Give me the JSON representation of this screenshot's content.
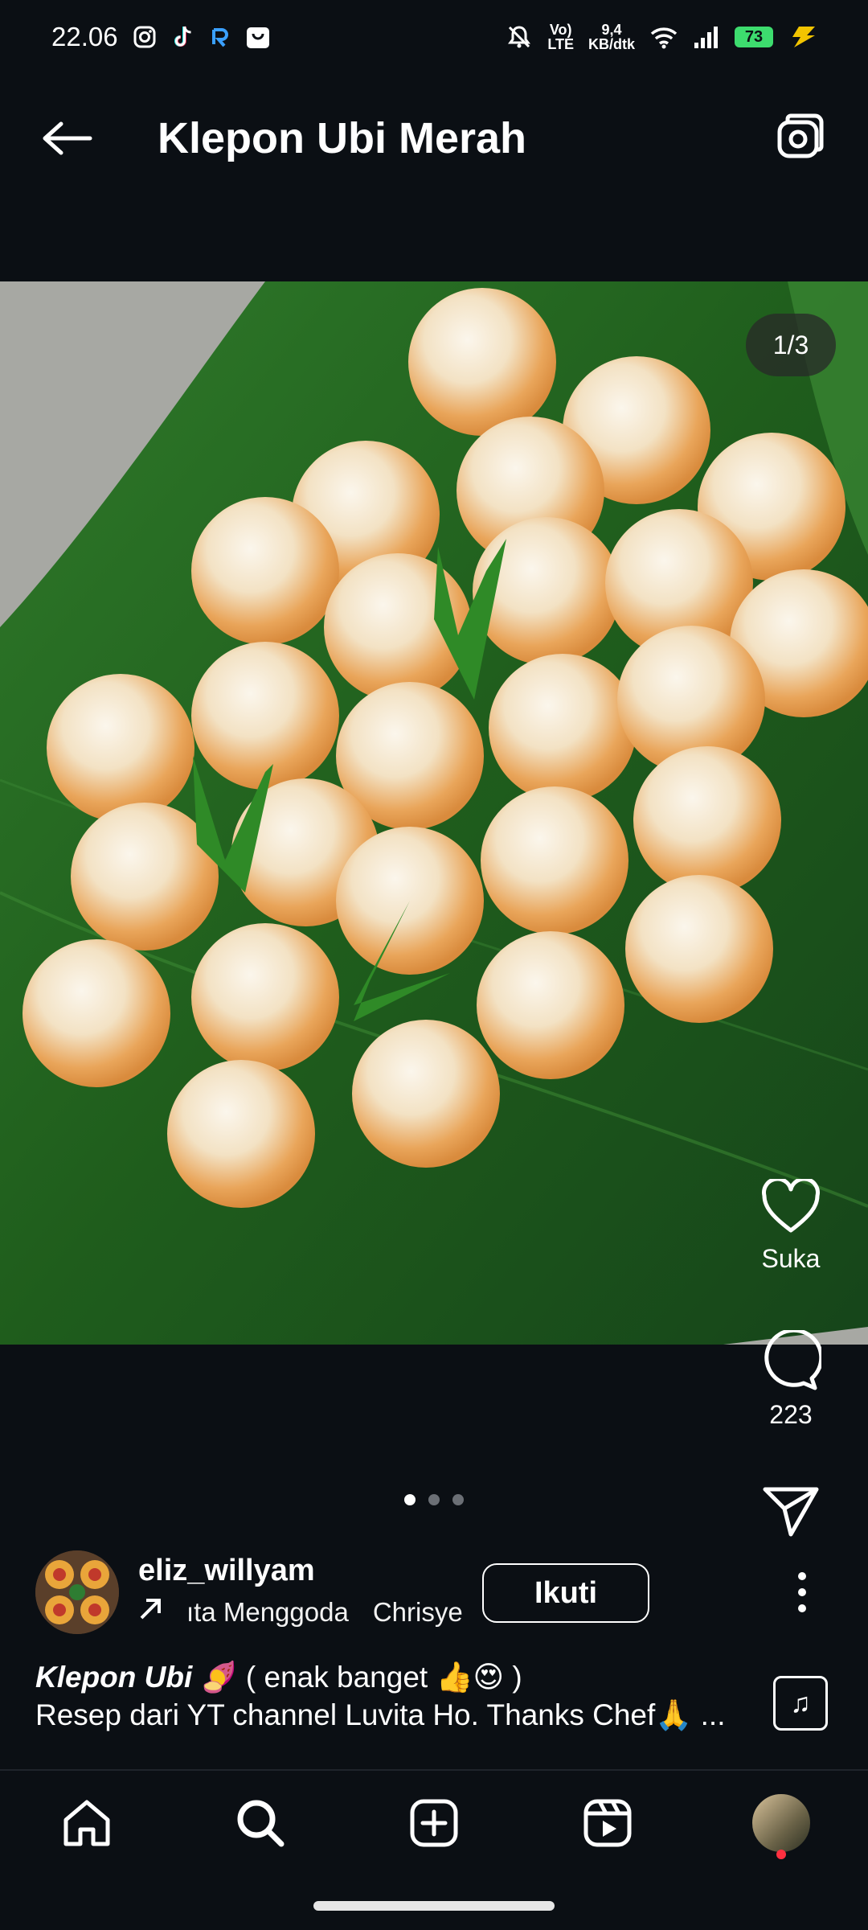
{
  "status_bar": {
    "time": "22.06",
    "network_speed_value": "9,4",
    "network_speed_unit": "KB/dtk",
    "battery_level": "73"
  },
  "header": {
    "title": "Klepon Ubi Merah"
  },
  "photo": {
    "counter": "1/3"
  },
  "actions": {
    "like_label": "Suka",
    "comment_count": "223"
  },
  "pagination": {
    "total": 3,
    "active": 1
  },
  "author": {
    "username": "eliz_willyam",
    "music_title": "ıta Menggoda",
    "music_artist": "Chrisye",
    "follow_label": "Ikuti"
  },
  "caption": {
    "title": "Klepon Ubi",
    "title_tail": " 🍠 ( enak banget 👍😍 )",
    "line2": "Resep dari YT channel Luvita Ho. Thanks Chef🙏",
    "more": "..."
  },
  "icons": {
    "back": "arrow-left-icon",
    "camera": "camera-icon",
    "like": "heart-icon",
    "comment": "comment-icon",
    "share": "paper-plane-icon",
    "more": "more-vertical-icon",
    "music": "music-note-icon",
    "home": "home-icon",
    "search": "search-icon",
    "create": "plus-square-icon",
    "reels": "reels-icon"
  },
  "colors": {
    "background": "#0b0f14",
    "battery": "#3ddc6e",
    "notification_dot": "#ff3040"
  }
}
